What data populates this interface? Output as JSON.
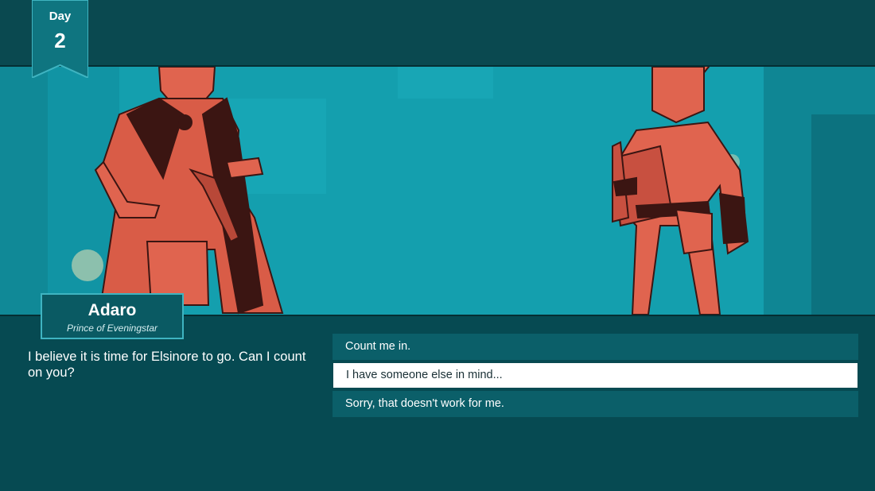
{
  "day": {
    "label": "Day",
    "number": "2"
  },
  "speaker": {
    "name": "Adaro",
    "title": "Prince of Eveningstar"
  },
  "dialogue": {
    "text": "I believe it is time for Elsinore to go. Can I count on you?"
  },
  "choices": [
    {
      "label": "Count me in.",
      "selected": false
    },
    {
      "label": "I have someone else in mind...",
      "selected": true
    },
    {
      "label": "Sorry, that doesn't work for me.",
      "selected": false
    }
  ],
  "colors": {
    "panel_bg": "#064a52",
    "scene_bg": "#149fae",
    "character": "#e0644f",
    "choice_bg": "#0b5f69",
    "choice_selected_bg": "#ffffff",
    "nameplate_border": "#3fb4c1"
  },
  "characters": [
    {
      "kind": "leopard"
    },
    {
      "kind": "rabbit"
    }
  ]
}
